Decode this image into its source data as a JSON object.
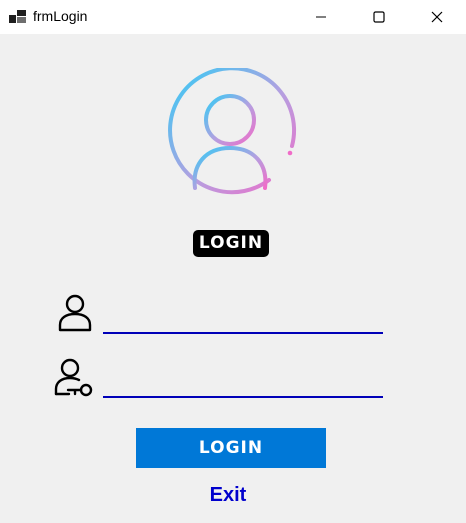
{
  "window": {
    "title": "frmLogin",
    "icon": "app-icon",
    "controls": [
      "minimize-icon",
      "maximize-icon",
      "close-icon"
    ]
  },
  "header": {
    "avatar_icon": "user-circle-icon",
    "badge_text": "LOGIN"
  },
  "form": {
    "username": {
      "icon": "user-icon",
      "value": "",
      "placeholder": ""
    },
    "password": {
      "icon": "user-key-icon",
      "value": "",
      "placeholder": ""
    }
  },
  "actions": {
    "login_label": "LOGIN",
    "exit_label": "Exit"
  },
  "colors": {
    "accent": "#0078d7",
    "field_underline": "#0000b8",
    "exit_link": "#0000cd",
    "gradient_start": "#33ccf5",
    "gradient_end": "#f06cc8"
  }
}
